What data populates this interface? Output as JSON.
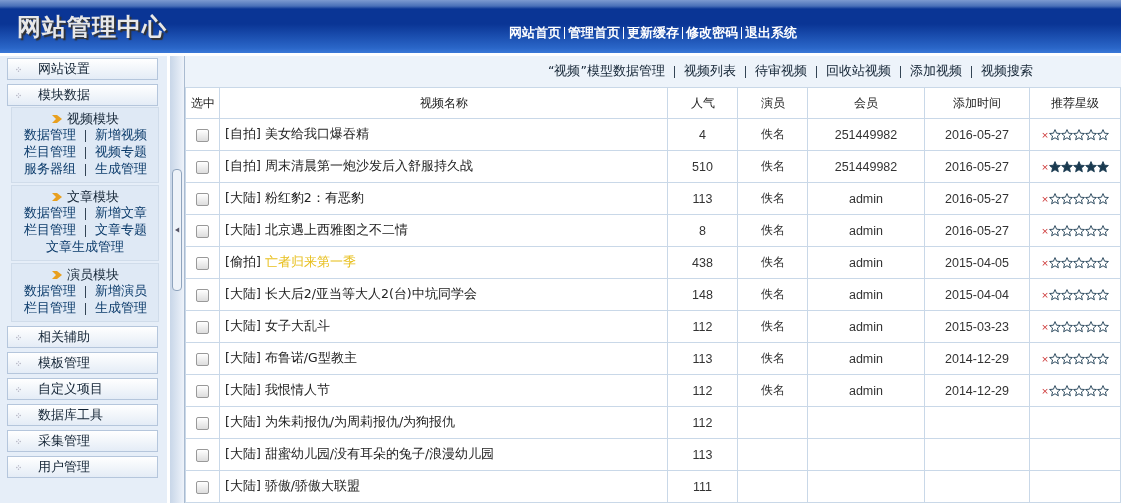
{
  "header": {
    "title": "网站管理中心",
    "nav": [
      "网站首页",
      "管理首页",
      "更新缓存",
      "修改密码",
      "退出系统"
    ]
  },
  "sidebar": {
    "menus": [
      {
        "label": "网站设置"
      },
      {
        "label": "模块数据",
        "sections": [
          {
            "title": "视频模块",
            "links": [
              [
                "数据管理",
                "新增视频"
              ],
              [
                "栏目管理",
                "视频专题"
              ],
              [
                "服务器组",
                "生成管理"
              ]
            ]
          },
          {
            "title": "文章模块",
            "links": [
              [
                "数据管理",
                "新增文章"
              ],
              [
                "栏目管理",
                "文章专题"
              ],
              [
                "文章生成管理"
              ]
            ]
          },
          {
            "title": "演员模块",
            "links": [
              [
                "数据管理",
                "新增演员"
              ],
              [
                "栏目管理",
                "生成管理"
              ]
            ]
          }
        ]
      },
      {
        "label": "相关辅助"
      },
      {
        "label": "模板管理"
      },
      {
        "label": "自定义项目"
      },
      {
        "label": "数据库工具"
      },
      {
        "label": "采集管理"
      },
      {
        "label": "用户管理"
      }
    ]
  },
  "toolbar": {
    "title": "“视频”模型数据管理",
    "links": [
      "视频列表",
      "待审视频",
      "回收站视频",
      "添加视频",
      "视频搜索"
    ]
  },
  "table": {
    "columns": [
      "选中",
      "视频名称",
      "人气",
      "演员",
      "会员",
      "添加时间",
      "推荐星级"
    ],
    "rows": [
      {
        "checked": false,
        "tag": "[自拍]",
        "name": "美女给我口爆吞精",
        "highlight": false,
        "views": "4",
        "actor": "佚名",
        "member": "251449982",
        "date": "2016-05-27",
        "clear": "×",
        "stars": 0
      },
      {
        "checked": false,
        "tag": "[自拍]",
        "name": "周末清晨第一炮沙发后入舒服持久战",
        "highlight": false,
        "views": "510",
        "actor": "佚名",
        "member": "251449982",
        "date": "2016-05-27",
        "clear": "×",
        "stars": 5
      },
      {
        "checked": false,
        "tag": "[大陆]",
        "name": "粉红豹2：有恶豹",
        "highlight": false,
        "views": "113",
        "actor": "佚名",
        "member": "admin",
        "date": "2016-05-27",
        "clear": "×",
        "stars": 0
      },
      {
        "checked": false,
        "tag": "[大陆]",
        "name": "北京遇上西雅图之不二情",
        "highlight": false,
        "views": "8",
        "actor": "佚名",
        "member": "admin",
        "date": "2016-05-27",
        "clear": "×",
        "stars": 0
      },
      {
        "checked": false,
        "tag": "[偷拍]",
        "name": "亡者归来第一季",
        "highlight": true,
        "views": "438",
        "actor": "佚名",
        "member": "admin",
        "date": "2015-04-05",
        "clear": "×",
        "stars": 0
      },
      {
        "checked": false,
        "tag": "[大陆]",
        "name": "长大后2/亚当等大人2(台)中坑同学会",
        "highlight": false,
        "views": "148",
        "actor": "佚名",
        "member": "admin",
        "date": "2015-04-04",
        "clear": "×",
        "stars": 0
      },
      {
        "checked": false,
        "tag": "[大陆]",
        "name": "女子大乱斗",
        "highlight": false,
        "views": "112",
        "actor": "佚名",
        "member": "admin",
        "date": "2015-03-23",
        "clear": "×",
        "stars": 0
      },
      {
        "checked": false,
        "tag": "[大陆]",
        "name": "布鲁诺/G型教主",
        "highlight": false,
        "views": "113",
        "actor": "佚名",
        "member": "admin",
        "date": "2014-12-29",
        "clear": "×",
        "stars": 0
      },
      {
        "checked": false,
        "tag": "[大陆]",
        "name": "我恨情人节",
        "highlight": false,
        "views": "112",
        "actor": "佚名",
        "member": "admin",
        "date": "2014-12-29",
        "clear": "×",
        "stars": 0
      },
      {
        "checked": false,
        "tag": "[大陆]",
        "name": "为朱莉报仇/为周莉报仇/为狗报仇",
        "highlight": false,
        "views": "112"
      },
      {
        "checked": false,
        "tag": "[大陆]",
        "name": "甜蜜幼儿园/没有耳朵的兔子/浪漫幼儿园",
        "highlight": false,
        "views": "113"
      },
      {
        "checked": false,
        "tag": "[大陆]",
        "name": "骄傲/骄傲大联盟",
        "highlight": false,
        "views": "111"
      }
    ]
  }
}
